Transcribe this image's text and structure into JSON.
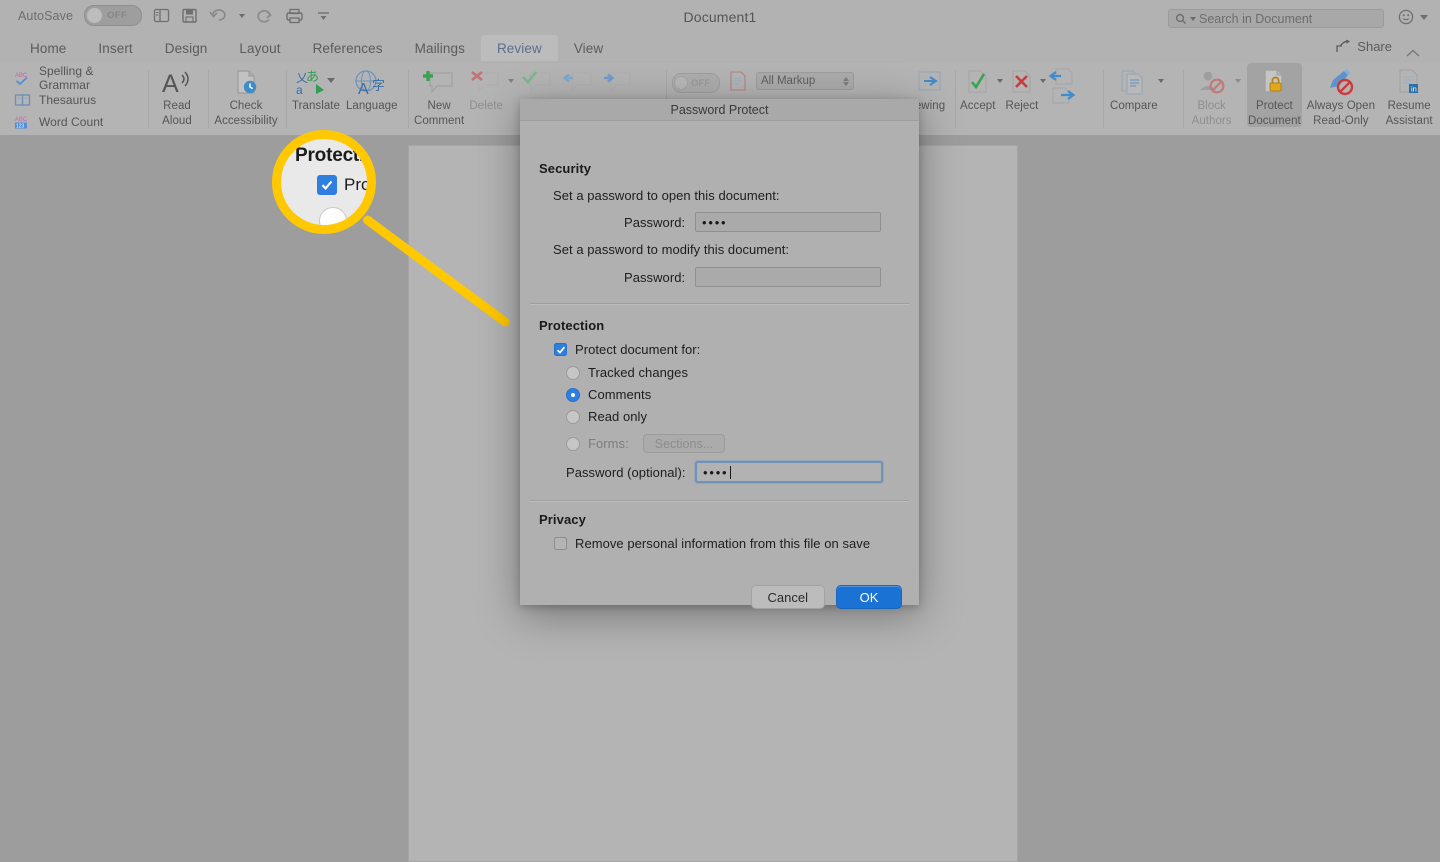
{
  "app": {
    "title": "Document1",
    "autosave_label": "AutoSave",
    "autosave_state": "OFF",
    "share_label": "Share",
    "search_placeholder": "Search in Document",
    "quick_access": [
      {
        "name": "layout-icon",
        "label": "Layout"
      },
      {
        "name": "save-icon",
        "label": "Save"
      },
      {
        "name": "undo-icon",
        "label": "Undo"
      },
      {
        "name": "redo-icon",
        "label": "Redo"
      },
      {
        "name": "print-icon",
        "label": "Print"
      },
      {
        "name": "customize-toolbar-icon",
        "label": "Customize"
      }
    ]
  },
  "tabs": [
    {
      "label": "Home",
      "active": false
    },
    {
      "label": "Insert",
      "active": false
    },
    {
      "label": "Design",
      "active": false
    },
    {
      "label": "Layout",
      "active": false
    },
    {
      "label": "References",
      "active": false
    },
    {
      "label": "Mailings",
      "active": false
    },
    {
      "label": "Review",
      "active": true
    },
    {
      "label": "View",
      "active": false
    }
  ],
  "ribbon": {
    "proofing": [
      {
        "label": "Spelling & Grammar",
        "icon": "spelling-check-icon"
      },
      {
        "label": "Thesaurus",
        "icon": "thesaurus-book-icon"
      },
      {
        "label": "Word Count",
        "icon": "word-count-icon"
      }
    ],
    "speech": {
      "line1": "Read",
      "line2": "Aloud",
      "icon": "read-aloud-icon"
    },
    "accessibility": {
      "line1": "Check",
      "line2": "Accessibility",
      "icon": "check-accessibility-icon"
    },
    "translate": {
      "label": "Translate",
      "icon": "translate-icon"
    },
    "language": {
      "label": "Language",
      "icon": "language-icon"
    },
    "new_comment": {
      "line1": "New",
      "line2": "Comment",
      "icon": "new-comment-icon"
    },
    "delete_comment": {
      "label": "Delete",
      "icon": "delete-comment-icon"
    },
    "previous_comment": {
      "label": "Previous",
      "icon": "previous-comment-icon"
    },
    "next_comment": {
      "label": "Next",
      "icon": "next-comment-icon"
    },
    "resolve_comment": {
      "label": "Resolve",
      "icon": "resolve-comment-icon"
    },
    "track_changes_state": "OFF",
    "markup_view": "All Markup",
    "reviewing_pane": {
      "label": "ewing",
      "icon": "reviewing-pane-icon"
    },
    "accept": {
      "label": "Accept",
      "icon": "accept-change-icon"
    },
    "reject": {
      "label": "Reject",
      "icon": "reject-change-icon"
    },
    "compare": {
      "label": "Compare",
      "icon": "compare-documents-icon"
    },
    "block_authors": {
      "line1": "Block",
      "line2": "Authors",
      "icon": "block-authors-icon"
    },
    "protect_document": {
      "line1": "Protect",
      "line2": "Document",
      "icon": "protect-document-icon"
    },
    "always_open_read_only": {
      "line1": "Always Open",
      "line2": "Read-Only",
      "icon": "always-open-read-only-icon"
    },
    "resume_assistant": {
      "line1": "Resume",
      "line2": "Assistant",
      "icon": "resume-assistant-icon"
    }
  },
  "callout": {
    "magnified_heading": "Protection",
    "magnified_option": "Protect document for:",
    "highlight_color": "#ffc800"
  },
  "dialog": {
    "title": "Password Protect",
    "security": {
      "heading": "Security",
      "open_label": "Set a password to open this document:",
      "open_field_label": "Password:",
      "open_field_value": "••••",
      "modify_label": "Set a password to modify this document:",
      "modify_field_label": "Password:",
      "modify_field_value": ""
    },
    "protection": {
      "heading": "Protection",
      "protect_checkbox_label": "Protect document for:",
      "protect_checked": true,
      "options": [
        {
          "label": "Tracked changes",
          "selected": false,
          "disabled": false
        },
        {
          "label": "Comments",
          "selected": true,
          "disabled": false
        },
        {
          "label": "Read only",
          "selected": false,
          "disabled": false
        },
        {
          "label": "Forms:",
          "selected": false,
          "disabled": true
        }
      ],
      "sections_button": "Sections...",
      "password_label": "Password (optional):",
      "password_value": "••••"
    },
    "privacy": {
      "heading": "Privacy",
      "remove_info_label": "Remove personal information from this file on save",
      "remove_info_checked": false
    },
    "buttons": {
      "cancel": "Cancel",
      "ok": "OK"
    },
    "accent_color": "#1a72d4"
  }
}
